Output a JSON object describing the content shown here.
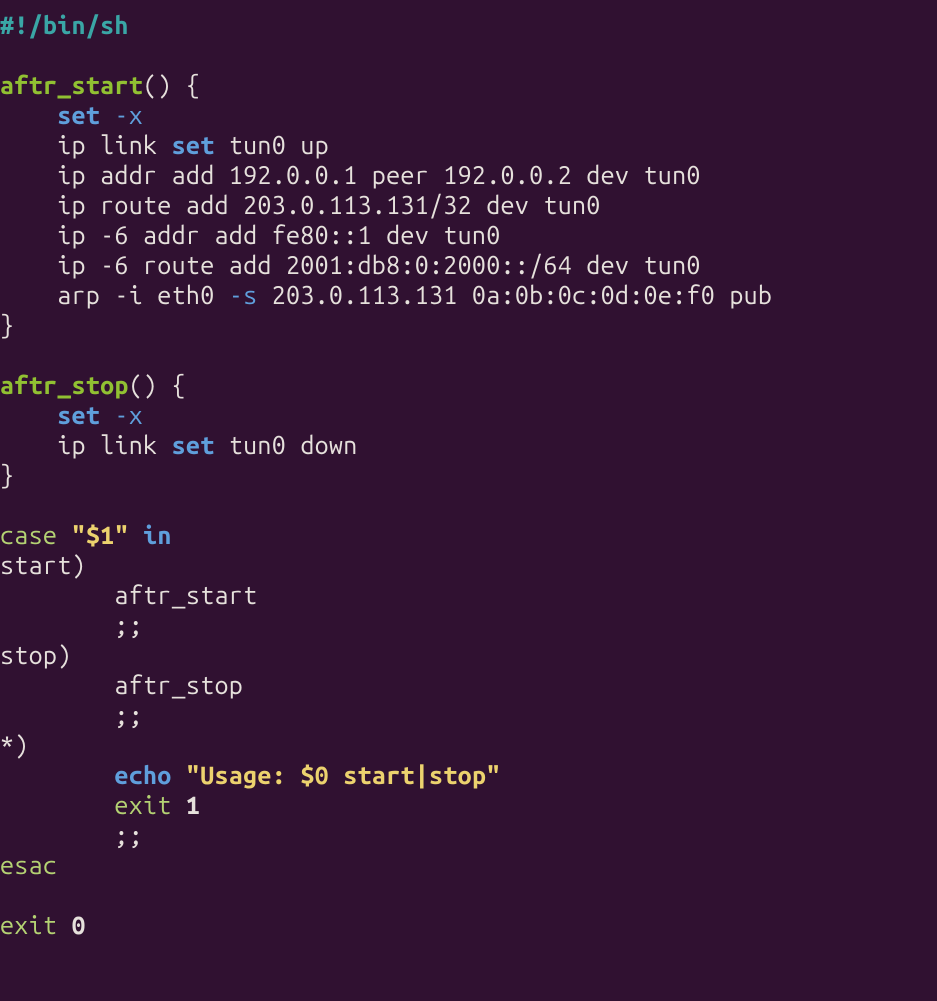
{
  "code": {
    "shebang": "#!/bin/sh",
    "fn_start_name": "aftr_start",
    "fn_stop_name": "aftr_stop",
    "set_kw": "set",
    "set_flag": "-x",
    "ip_link_set_pre": "ip link ",
    "ip_link_set_kw": "set",
    "tun_up": " tun0 up",
    "ip_addr_add": "ip addr add 192.0.0.1 peer 192.0.0.2 dev tun0",
    "ip_route_add": "ip route add 203.0.113.131/32 dev tun0",
    "ip6_addr_add": "ip -6 addr add fe80::1 dev tun0",
    "ip6_route_add": "ip -6 route add 2001:db8:0:2000::/64 dev tun0",
    "arp_pre": "arp -i eth0 ",
    "arp_flag": "-s",
    "arp_post": " 203.0.113.131 0a:0b:0c:0d:0e:f0 pub",
    "tun_down": " tun0 down",
    "case_kw": "case",
    "case_arg_open": "\"",
    "case_var": "$1",
    "case_arg_close": "\"",
    "in_kw": "in",
    "label_start": "start",
    "label_stop": "stop",
    "label_star": "*",
    "aftr_start_call": "aftr_start",
    "aftr_stop_call": "aftr_stop",
    "dsemi": ";;",
    "echo_kw": "echo",
    "echo_str_open": "\"Usage: ",
    "echo_var": "$0",
    "echo_str_close": " start|stop\"",
    "exit_kw": "exit",
    "exit_1": "1",
    "exit_0": "0",
    "esac_kw": "esac",
    "paren_pair": "()",
    "paren_close": ")",
    "brace_open": "{",
    "brace_close": "}"
  }
}
